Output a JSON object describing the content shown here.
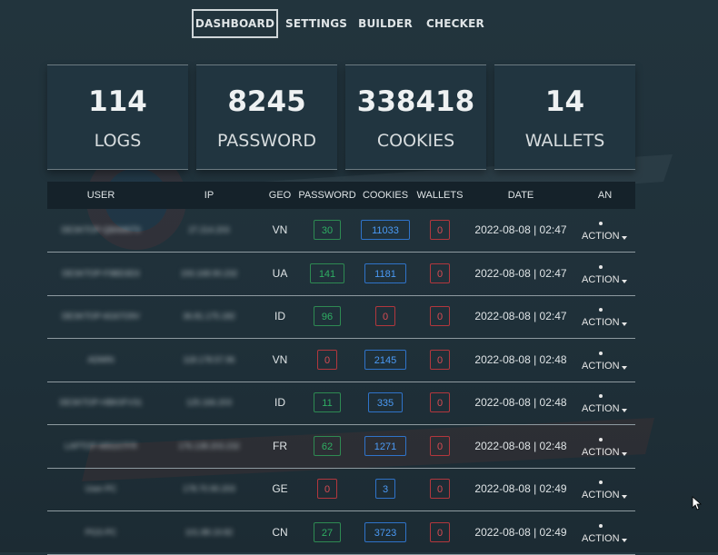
{
  "nav": {
    "items": [
      {
        "label": "DASHBOARD",
        "active": true
      },
      {
        "label": "SETTINGS",
        "active": false
      },
      {
        "label": "BUILDER",
        "active": false
      },
      {
        "label": "CHECKER",
        "active": false
      }
    ]
  },
  "stats": [
    {
      "value": "114",
      "label": "LOGS"
    },
    {
      "value": "8245",
      "label": "PASSWORD"
    },
    {
      "value": "338418",
      "label": "COOKIES"
    },
    {
      "value": "14",
      "label": "WALLETS"
    }
  ],
  "table": {
    "headers": [
      "USER",
      "IP",
      "GEO",
      "PASSWORD",
      "COOKIES",
      "WALLETS",
      "DATE",
      "AN"
    ],
    "rows": [
      {
        "user": "DESKTOP-Q8AM6T9",
        "ip": "27.214.203",
        "geo": "VN",
        "password": "30",
        "cookies": "11033",
        "wallets": "0",
        "date": "2022-08-08 | 02:47",
        "action": "ACTION"
      },
      {
        "user": "DESKTOP-F9BD3D3",
        "ip": "193.168.90.232",
        "geo": "UA",
        "password": "141",
        "cookies": "1181",
        "wallets": "0",
        "date": "2022-08-08 | 02:47",
        "action": "ACTION"
      },
      {
        "user": "DESKTOP-6G67O9V",
        "ip": "36.81.175.182",
        "geo": "ID",
        "password": "96",
        "cookies": "0",
        "wallets": "0",
        "date": "2022-08-08 | 02:47",
        "action": "ACTION"
      },
      {
        "user": "ADMIN",
        "ip": "118.178.57.96",
        "geo": "VN",
        "password": "0",
        "cookies": "2145",
        "wallets": "0",
        "date": "2022-08-08 | 02:48",
        "action": "ACTION"
      },
      {
        "user": "DESKTOP-HBK0FV31",
        "ip": "125.166.203",
        "geo": "ID",
        "password": "11",
        "cookies": "335",
        "wallets": "0",
        "date": "2022-08-08 | 02:48",
        "action": "ACTION"
      },
      {
        "user": "LAPTOP-M5G07FR",
        "ip": "176.138.203.232",
        "geo": "FR",
        "password": "62",
        "cookies": "1271",
        "wallets": "0",
        "date": "2022-08-08 | 02:48",
        "action": "ACTION"
      },
      {
        "user": "User-PC",
        "ip": "178.70.90.203",
        "geo": "GE",
        "password": "0",
        "cookies": "3",
        "wallets": "0",
        "date": "2022-08-08 | 02:49",
        "action": "ACTION"
      },
      {
        "user": "PGS-PC",
        "ip": "101.88.19.82",
        "geo": "CN",
        "password": "27",
        "cookies": "3723",
        "wallets": "0",
        "date": "2022-08-08 | 02:49",
        "action": "ACTION"
      }
    ]
  },
  "colors": {
    "background": "#203139",
    "green": "#2fae63",
    "blue": "#4b9af5",
    "red": "#d84b53"
  },
  "icons": {
    "action_dropdown": "caret-down-icon",
    "cursor": "mouse-pointer-icon"
  }
}
